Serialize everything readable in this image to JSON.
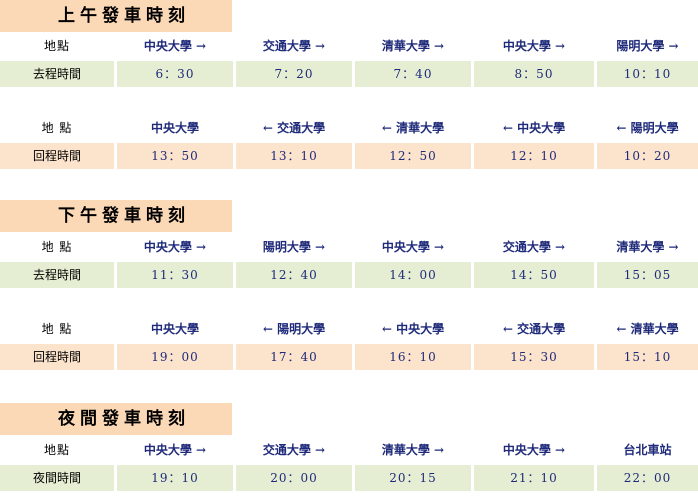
{
  "sections": [
    {
      "title": "上午發車時刻",
      "tables": [
        {
          "header_label": "地點",
          "stops": [
            "中央大學 →",
            "交通大學 →",
            "清華大學 →",
            "中央大學 →",
            "陽明大學 →"
          ],
          "row_label": "去程時間",
          "times": [
            "6：30",
            "7：20",
            "7：40",
            "8：50",
            "10：10"
          ]
        },
        {
          "header_label": "地 點",
          "stops": [
            "中央大學",
            "← 交通大學",
            "← 清華大學",
            "← 中央大學",
            "← 陽明大學"
          ],
          "row_label": "回程時間",
          "times": [
            "13：50",
            "13：10",
            "12：50",
            "12：10",
            "10：20"
          ]
        }
      ]
    },
    {
      "title": "下午發車時刻",
      "tables": [
        {
          "header_label": "地 點",
          "stops": [
            "中央大學 →",
            "陽明大學 →",
            "中央大學 →",
            "交通大學 →",
            "清華大學 →"
          ],
          "row_label": "去程時間",
          "times": [
            "11：30",
            "12：40",
            "14：00",
            "14：50",
            "15：05"
          ]
        },
        {
          "header_label": "地 點",
          "stops": [
            "中央大學",
            "← 陽明大學",
            "← 中央大學",
            "← 交通大學",
            "← 清華大學"
          ],
          "row_label": "回程時間",
          "times": [
            "19：00",
            "17：40",
            "16：10",
            "15：30",
            "15：10"
          ]
        }
      ]
    },
    {
      "title": "夜間發車時刻",
      "tables": [
        {
          "header_label": "地點",
          "stops": [
            "中央大學 →",
            "交通大學 →",
            "清華大學 →",
            "中央大學 →",
            "台北車站"
          ],
          "row_label": "夜間時間",
          "times": [
            "19：10",
            "20：00",
            "20：15",
            "21：10",
            "22：00"
          ]
        }
      ]
    }
  ],
  "colors": {
    "title_bg": "#fcd9b6",
    "outbound_row_bg": "#e5eed3",
    "return_row_bg": "#fce3cc",
    "stop_text": "#1f2a7a"
  }
}
